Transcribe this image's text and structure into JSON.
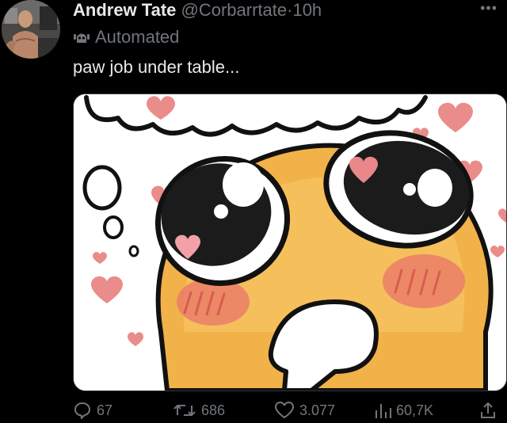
{
  "tweet": {
    "display_name": "Andrew Tate",
    "handle": "@Corbarrtate",
    "separator": "·",
    "time": "10h",
    "automated_label": "Automated",
    "text": "paw job under table...",
    "more_icon": "more-horizontal-icon"
  },
  "actions": {
    "replies": "67",
    "reposts": "686",
    "likes": "3.077",
    "views": "60,7K"
  },
  "colors": {
    "background": "#000000",
    "text": "#e7e9ea",
    "muted": "#71767b",
    "blush": "#e8766a",
    "face": "#f2b24a"
  }
}
